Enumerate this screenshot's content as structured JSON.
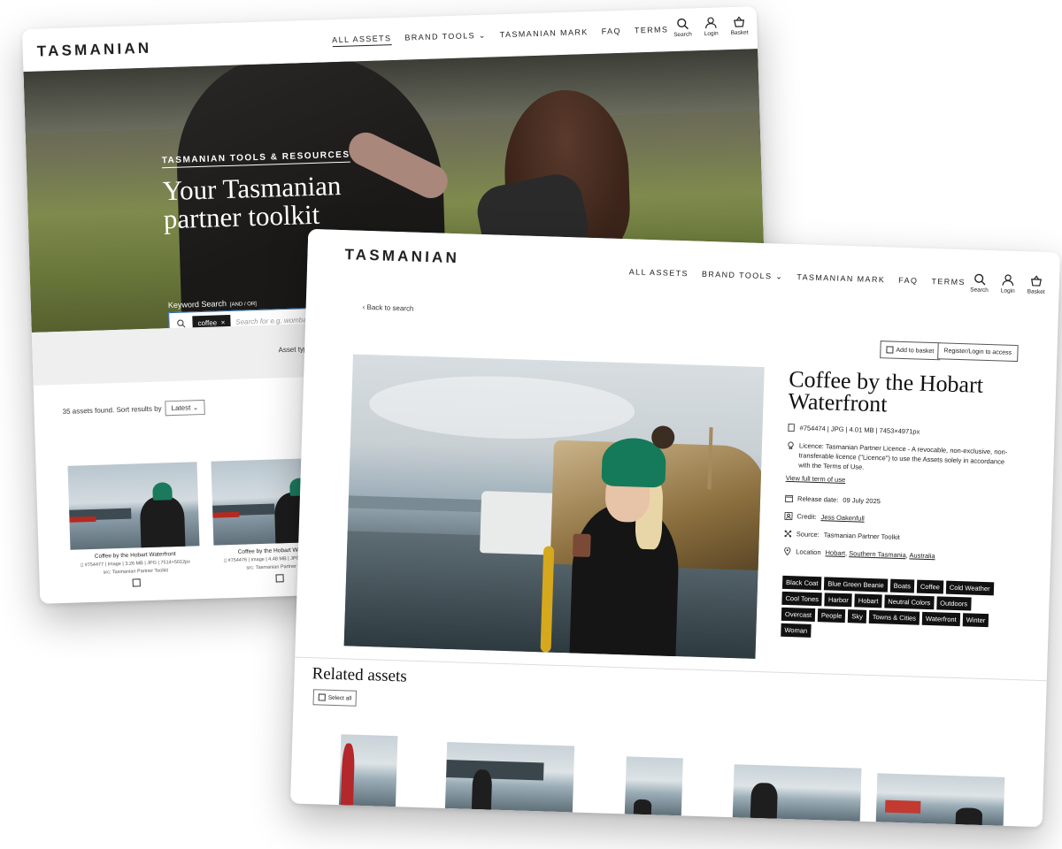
{
  "brand": {
    "logo_text": "TASMANIAN"
  },
  "nav": {
    "items": [
      "ALL ASSETS",
      "BRAND TOOLS",
      "TASMANIAN MARK",
      "FAQ",
      "TERMS"
    ],
    "icons": [
      {
        "label": "Search",
        "icon": "search-icon"
      },
      {
        "label": "Login",
        "icon": "user-icon"
      },
      {
        "label": "Basket",
        "icon": "basket-icon",
        "count": "0"
      }
    ]
  },
  "search_page": {
    "hero_eyebrow": "TASMANIAN TOOLS & RESOURCES",
    "hero_title_line1": "Your Tasmanian",
    "hero_title_line2": "partner toolkit",
    "keyword_label": "Keyword Search",
    "keyword_hint": "[AND / OR]",
    "chip_label": "coffee",
    "chip_close": "×",
    "search_placeholder": "Search for e.g. wombat or te",
    "asset_type_label": "Asset type",
    "results_text": "35 assets found. Sort results by",
    "sort_value": "Latest",
    "cards": [
      {
        "title": "Coffee by the Hobart Waterfront",
        "meta": "#754477 | Image | 3.26 MB | JPG | 7514×5012px",
        "src": "src: Tasmanian Partner Toolkit"
      },
      {
        "title": "Coffee by the Hobart Waterfront",
        "meta": "#754476 | Image | 4.48 MB | JPG | 7514×5012px",
        "src": "src: Tasmanian Partner Toolkit"
      }
    ]
  },
  "detail_page": {
    "back_label": "Back to search",
    "add_to_basket": "Add to basket",
    "register_login": "Register/Login to access",
    "title_line1": "Coffee by the Hobart",
    "title_line2": "Waterfront",
    "file_meta": "#754474 | JPG | 4.01 MB | 7453×4971px",
    "licence": "Licence: Tasmanian Partner Licence - A revocable, non-exclusive, non-transferable licence (\"Licence\") to use the Assets solely in accordance with the Terms of Use.",
    "view_terms": "View full term of use",
    "release_label": "Release date:",
    "release_date": "09 July 2025",
    "credit_label": "Credit:",
    "credit_name": "Jess Oakenfull",
    "source_label": "Source:",
    "source_value": "Tasmanian Partner Toolkit",
    "location_label": "Location",
    "location_parts": [
      "Hobart",
      "Southern Tasmania",
      "Australia"
    ],
    "tags": [
      "Black Coat",
      "Blue Green Beanie",
      "Boats",
      "Coffee",
      "Cold Weather",
      "Cool Tones",
      "Harbor",
      "Hobart",
      "Neutral Colors",
      "Outdoors",
      "Overcast",
      "People",
      "Sky",
      "Towns & Cities",
      "Waterfront",
      "Winter",
      "Woman"
    ],
    "related_title": "Related assets",
    "select_all": "Select all"
  }
}
